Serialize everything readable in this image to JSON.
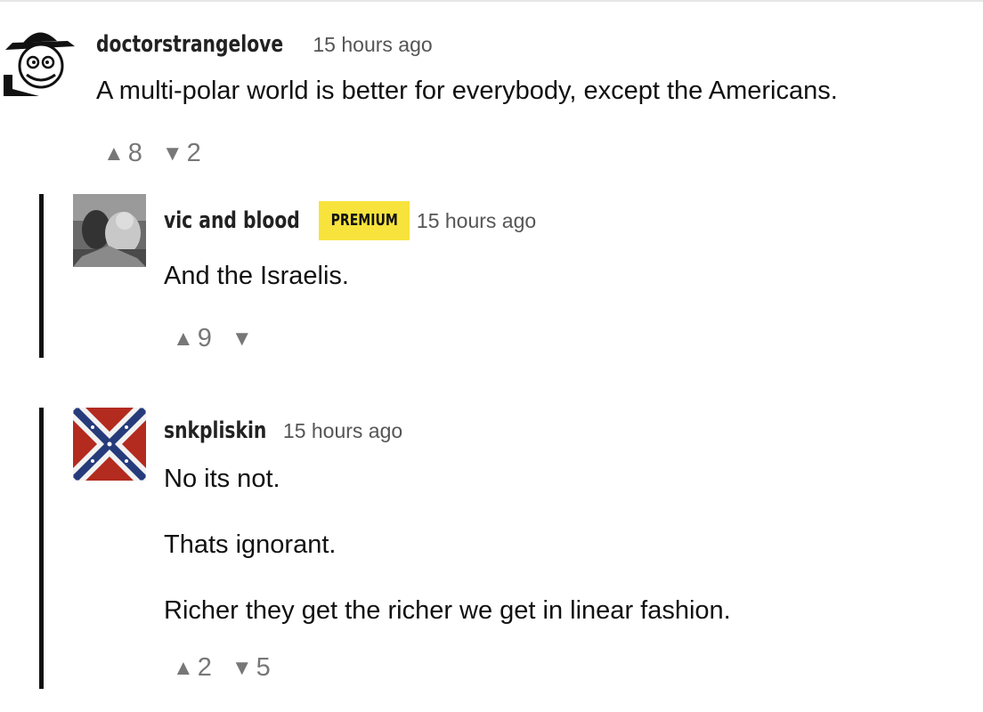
{
  "comments": [
    {
      "username": "doctorstrangelove",
      "time": "15 hours ago",
      "body": [
        "A multi-polar world is better for everybody, except the Americans."
      ],
      "upvotes": "8",
      "downvotes": "2"
    },
    {
      "username": "vic and blood",
      "badge": "PREMIUM",
      "time": "15 hours ago",
      "body": [
        "And the Israelis."
      ],
      "upvotes": "9",
      "downvotes": ""
    },
    {
      "username": "snkpliskin",
      "time": "15 hours ago",
      "body": [
        "No its not.",
        "Thats ignorant.",
        "Richer they get the richer we get in linear fashion."
      ],
      "upvotes": "2",
      "downvotes": "5"
    }
  ],
  "icons": {
    "upvote": "▲",
    "downvote": "▼"
  },
  "colors": {
    "premium_badge": "#f7e33c",
    "thread_bar": "#111111",
    "meta_text": "#555555",
    "vote_text": "#777777"
  }
}
